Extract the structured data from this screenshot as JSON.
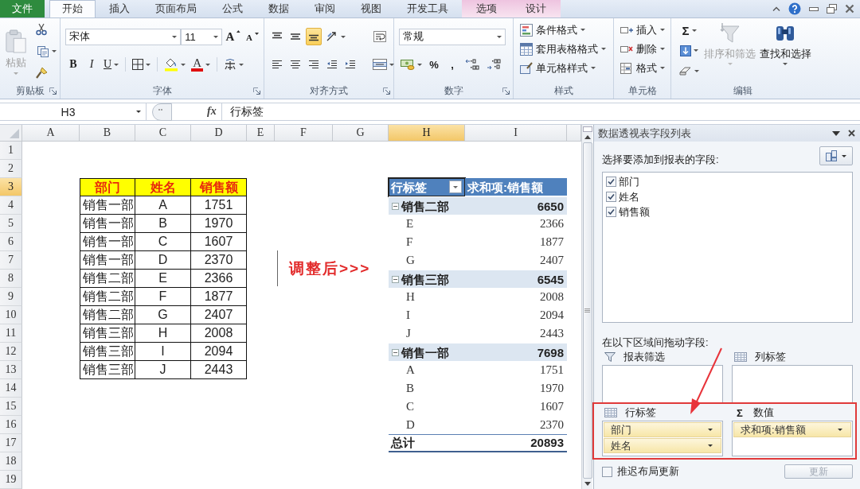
{
  "ribbon_tabs": [
    {
      "label": "文件",
      "kind": "file",
      "selected": false
    },
    {
      "label": "开始",
      "kind": "standard",
      "selected": true
    },
    {
      "label": "插入",
      "kind": "standard",
      "selected": false
    },
    {
      "label": "页面布局",
      "kind": "standard",
      "selected": false
    },
    {
      "label": "公式",
      "kind": "standard",
      "selected": false
    },
    {
      "label": "数据",
      "kind": "standard",
      "selected": false
    },
    {
      "label": "审阅",
      "kind": "standard",
      "selected": false
    },
    {
      "label": "视图",
      "kind": "standard",
      "selected": false
    },
    {
      "label": "开发工具",
      "kind": "standard",
      "selected": false
    },
    {
      "label": "选项",
      "kind": "contextual",
      "selected": false
    },
    {
      "label": "设计",
      "kind": "contextual",
      "selected": false
    }
  ],
  "ribbon": {
    "clipboard": {
      "label": "剪贴板",
      "paste": {
        "label": "粘贴",
        "disabled": true
      }
    },
    "font": {
      "label": "字体",
      "font_name": "宋体",
      "font_size": "11",
      "grow": "A",
      "shrink": "A",
      "bold": "B",
      "italic": "I",
      "underline": "U",
      "font_color": "A"
    },
    "alignment": {
      "label": "对齐方式",
      "vertical": [
        {
          "kind": "top",
          "selected": false
        },
        {
          "kind": "middle",
          "selected": false
        },
        {
          "kind": "bottom",
          "selected": true
        }
      ]
    },
    "number": {
      "label": "数字",
      "format": "常规",
      "percent": "%",
      "comma": ","
    },
    "styles": {
      "label": "样式",
      "commands": [
        "条件格式",
        "套用表格格式",
        "单元格样式"
      ]
    },
    "cells": {
      "label": "单元格",
      "commands": [
        "插入",
        "删除",
        "格式"
      ]
    },
    "editing": {
      "label": "编辑",
      "autosum": "Σ",
      "sort_filter": {
        "label": "排序和筛选",
        "disabled": true
      },
      "find_select": {
        "label": "查找和选择",
        "disabled": false
      }
    }
  },
  "formula_bar": {
    "name_box": "H3",
    "function_label": "fx",
    "formula": "行标签"
  },
  "sheet": {
    "columns": [
      {
        "label": "A",
        "selected": false
      },
      {
        "label": "B",
        "selected": false
      },
      {
        "label": "C",
        "selected": false
      },
      {
        "label": "D",
        "selected": false
      },
      {
        "label": "E",
        "selected": false
      },
      {
        "label": "F",
        "selected": false
      },
      {
        "label": "G",
        "selected": false
      },
      {
        "label": "H",
        "selected": true
      },
      {
        "label": "I",
        "selected": false
      }
    ],
    "rows": [
      {
        "label": "1",
        "selected": false
      },
      {
        "label": "2",
        "selected": false
      },
      {
        "label": "3",
        "selected": true
      },
      {
        "label": "4",
        "selected": false
      },
      {
        "label": "5",
        "selected": false
      },
      {
        "label": "6",
        "selected": false
      },
      {
        "label": "7",
        "selected": false
      },
      {
        "label": "8",
        "selected": false
      },
      {
        "label": "9",
        "selected": false
      },
      {
        "label": "10",
        "selected": false
      },
      {
        "label": "11",
        "selected": false
      },
      {
        "label": "12",
        "selected": false
      },
      {
        "label": "13",
        "selected": false
      },
      {
        "label": "14",
        "selected": false
      },
      {
        "label": "15",
        "selected": false
      },
      {
        "label": "16",
        "selected": false
      },
      {
        "label": "17",
        "selected": false
      },
      {
        "label": "18",
        "selected": false
      },
      {
        "label": "19",
        "selected": false
      }
    ]
  },
  "source_table": {
    "headers": [
      "部门",
      "姓名",
      "销售额"
    ],
    "rows": [
      [
        "销售一部",
        "A",
        "1751"
      ],
      [
        "销售一部",
        "B",
        "1970"
      ],
      [
        "销售一部",
        "C",
        "1607"
      ],
      [
        "销售一部",
        "D",
        "2370"
      ],
      [
        "销售二部",
        "E",
        "2366"
      ],
      [
        "销售二部",
        "F",
        "1877"
      ],
      [
        "销售二部",
        "G",
        "2407"
      ],
      [
        "销售三部",
        "H",
        "2008"
      ],
      [
        "销售三部",
        "I",
        "2094"
      ],
      [
        "销售三部",
        "J",
        "2443"
      ]
    ]
  },
  "annotation_text": "调整后>>>",
  "pivot_table": {
    "row_header": "行标签",
    "value_header": "求和项:销售额",
    "groups": [
      {
        "name": "销售二部",
        "total": "6650",
        "expanded": true,
        "items": [
          {
            "name": "E",
            "value": "2366"
          },
          {
            "name": "F",
            "value": "1877"
          },
          {
            "name": "G",
            "value": "2407"
          }
        ]
      },
      {
        "name": "销售三部",
        "total": "6545",
        "expanded": true,
        "items": [
          {
            "name": "H",
            "value": "2008"
          },
          {
            "name": "I",
            "value": "2094"
          },
          {
            "name": "J",
            "value": "2443"
          }
        ]
      },
      {
        "name": "销售一部",
        "total": "7698",
        "expanded": true,
        "items": [
          {
            "name": "A",
            "value": "1751"
          },
          {
            "name": "B",
            "value": "1970"
          },
          {
            "name": "C",
            "value": "1607"
          },
          {
            "name": "D",
            "value": "2370"
          }
        ]
      }
    ],
    "grand_total": {
      "label": "总计",
      "value": "20893"
    }
  },
  "field_list": {
    "title": "数据透视表字段列表",
    "prompt": "选择要添加到报表的字段:",
    "fields": [
      {
        "label": "部门",
        "checked": true
      },
      {
        "label": "姓名",
        "checked": true
      },
      {
        "label": "销售额",
        "checked": true
      }
    ],
    "drag_prompt": "在以下区域间拖动字段:",
    "areas": [
      {
        "kind": "filter",
        "label": "报表筛选"
      },
      {
        "kind": "columns",
        "label": "列标签"
      },
      {
        "kind": "rows",
        "label": "行标签",
        "items": [
          "部门",
          "姓名"
        ]
      },
      {
        "kind": "values",
        "label": "数值",
        "symbol": "Σ",
        "items": [
          "求和项:销售额"
        ]
      }
    ],
    "defer_update": {
      "label": "推迟布局更新",
      "checked": false
    },
    "update_button": {
      "label": "更新",
      "disabled": true
    }
  }
}
